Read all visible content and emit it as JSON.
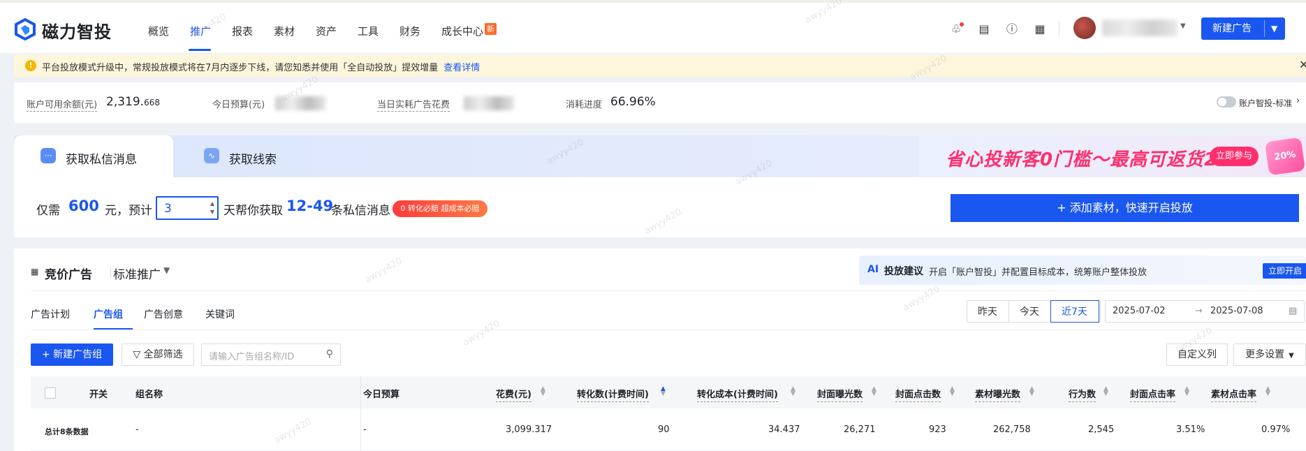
{
  "app": {
    "logo_text": "磁力智投"
  },
  "nav": {
    "items": [
      "概览",
      "推广",
      "报表",
      "素材",
      "资产",
      "工具",
      "财务",
      "成长中心"
    ],
    "active_index": 1,
    "new_badge": "新"
  },
  "header": {
    "new_ad_label": "新建广告"
  },
  "notice": {
    "text": "平台投放模式升级中，常规投放模式将在7月内逐步下线，请您知悉并使用「全自动投放」提效增量",
    "link": "查看详情"
  },
  "stats": {
    "balance_label": "账户可用余额(元)",
    "balance_value": "2,319.",
    "balance_decimal": "668",
    "budget_label": "今日预算(元)",
    "spend_label": "当日实耗广告花费",
    "progress_label": "消耗进度",
    "progress_value": "66.96%",
    "toggle_label": "账户智投-标准"
  },
  "promo": {
    "tab_private": "获取私信消息",
    "tab_leads": "获取线索",
    "banner_text": "省心投新客0门槛～最高可返货20%",
    "banner_btn": "立即参与",
    "gift_text": "20%",
    "only_need": "仅需",
    "amount": "600",
    "yuan_estimate": "元，预计",
    "days": "3",
    "help_get": "天帮你获取",
    "range": "12-49",
    "messages": "条私信消息",
    "pill": "0 转化必赔 超成本必赔",
    "add_material": "+ 添加素材，快速开启投放"
  },
  "main": {
    "bid_title": "竞价广告",
    "std_promo": "标准推广",
    "advice": {
      "ai": "AI",
      "title": "投放建议",
      "text": "开启「账户智投」并配置目标成本，统筹账户整体投放",
      "btn": "立即开启"
    },
    "subtabs": [
      "广告计划",
      "广告组",
      "广告创意",
      "关键词"
    ],
    "active_subtab": 1,
    "date_buttons": [
      "昨天",
      "今天",
      "近7天"
    ],
    "active_date": 2,
    "date_start": "2025-07-02",
    "date_end": "2025-07-08",
    "new_group_btn": "+ 新建广告组",
    "filter_btn": "全部筛选",
    "search_placeholder": "请输入广告组名称/ID",
    "custom_cols": "自定义列",
    "more_settings": "更多设置"
  },
  "table": {
    "headers": [
      "开关",
      "组名称",
      "今日预算",
      "花费(元)",
      "转化数(计费时间)",
      "转化成本(计费时间)",
      "封面曝光数",
      "封面点击数",
      "素材曝光数",
      "行为数",
      "封面点击率",
      "素材点击率"
    ],
    "summary_row": {
      "label": "总计8条数据",
      "name": "-",
      "budget": "-",
      "cost": "3,099.317",
      "conversions": "90",
      "conv_cost": "34.437",
      "cover_impr": "26,271",
      "cover_clicks": "923",
      "material_impr": "262,758",
      "actions": "2,545",
      "cover_ctr": "3.51%",
      "material_ctr": "0.97%"
    }
  },
  "watermark": "awyy420",
  "colors": {
    "accent": "#1a56f0",
    "promo_pink": "#ff2f6e",
    "notice_bg": "#fdf6dc"
  }
}
